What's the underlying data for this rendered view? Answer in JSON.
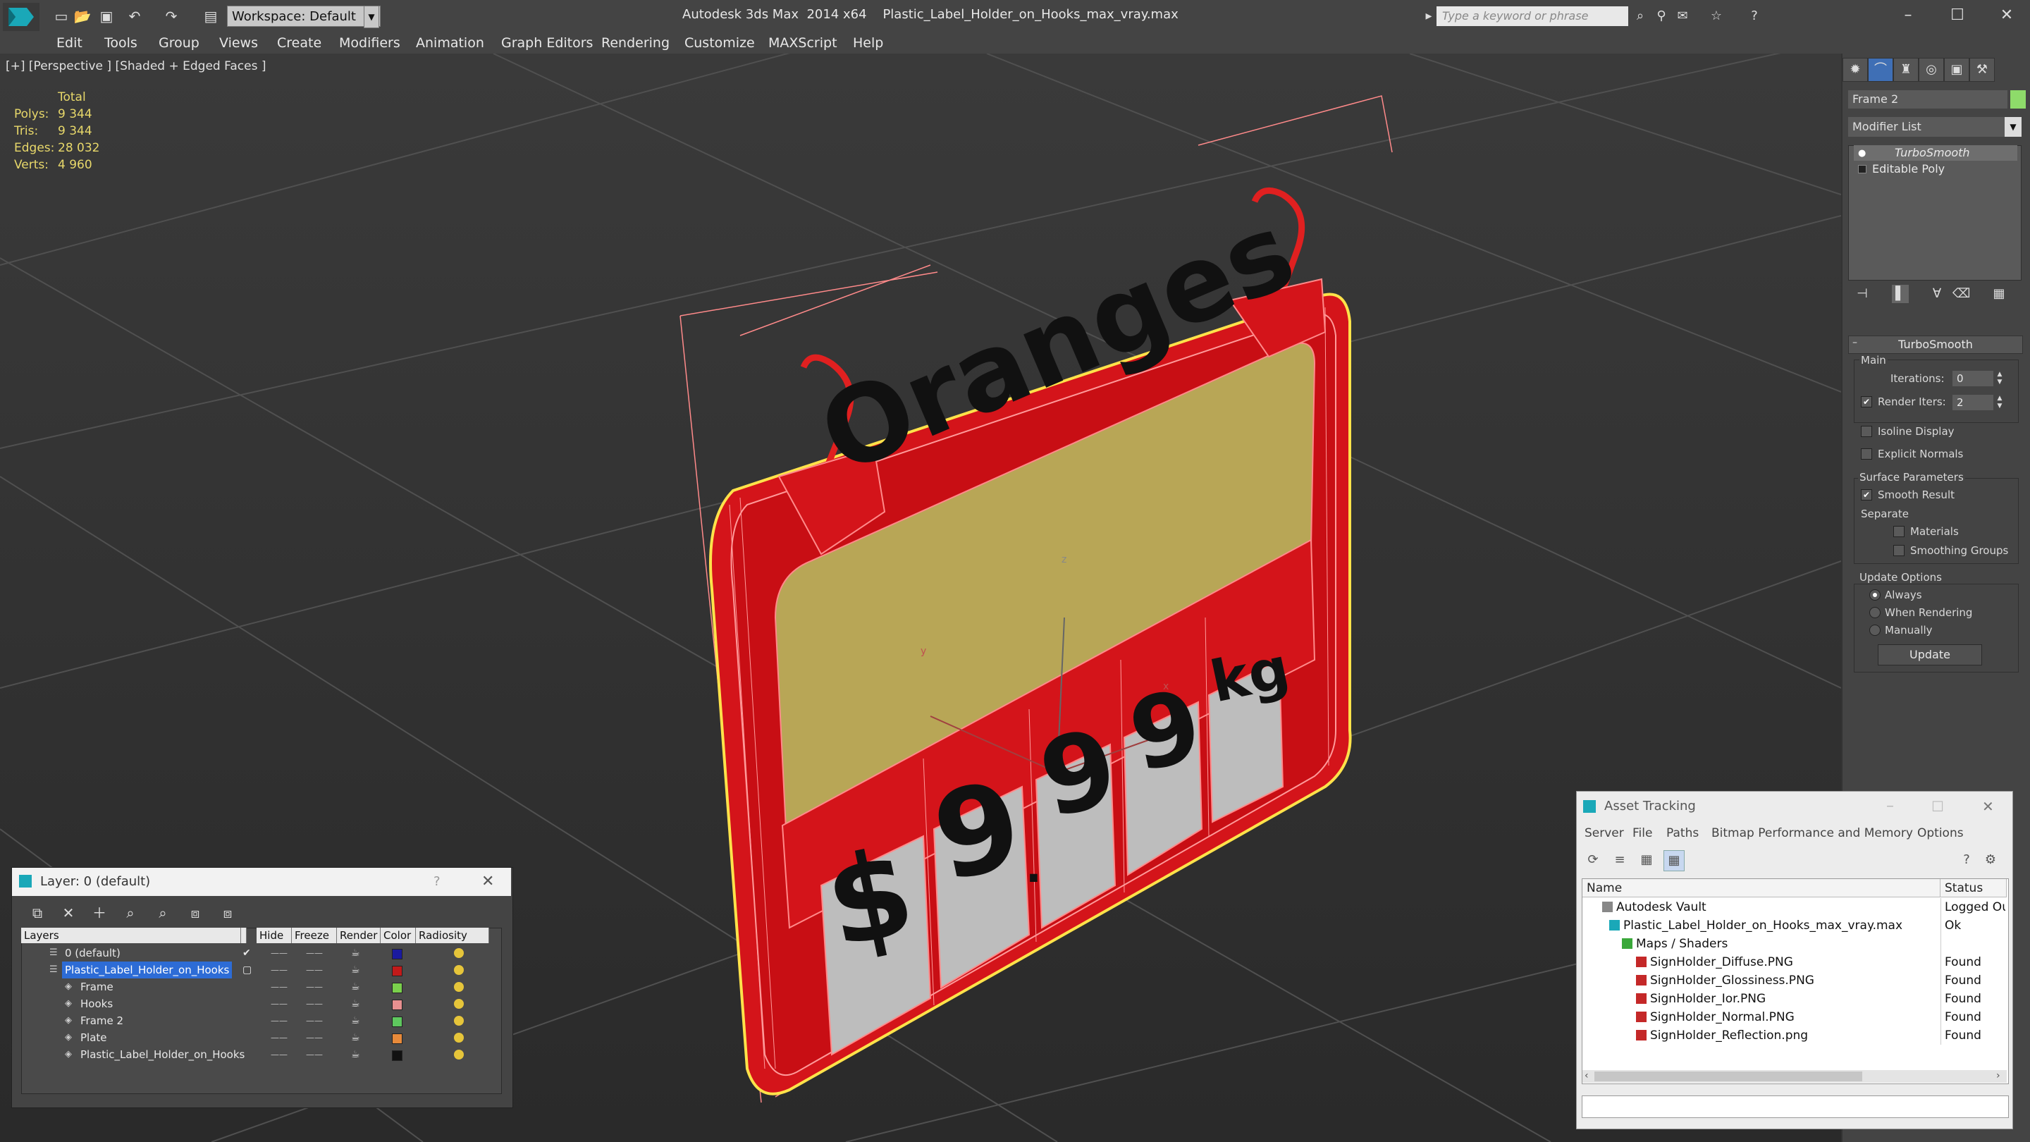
{
  "titlebar": {
    "workspace": "Workspace: Default",
    "app_name": "Autodesk 3ds Max  2014 x64",
    "file_name": "Plastic_Label_Holder_on_Hooks_max_vray.max",
    "search_placeholder": "Type a keyword or phrase"
  },
  "menus": [
    "Edit",
    "Tools",
    "Group",
    "Views",
    "Create",
    "Modifiers",
    "Animation",
    "Graph Editors",
    "Rendering",
    "Customize",
    "MAXScript",
    "Help"
  ],
  "viewport": {
    "label": "[+] [Perspective ] [Shaded + Edged Faces ]",
    "stats": {
      "total_label": "Total",
      "polys_label": "Polys:",
      "polys": "9 344",
      "tris_label": "Tris:",
      "tris": "9 344",
      "edges_label": "Edges:",
      "edges": "28 032",
      "verts_label": "Verts:",
      "verts": "4 960"
    },
    "sign": {
      "title": "Oranges",
      "currency": "$",
      "d1": "9",
      "dot": ".",
      "d2": "9",
      "d3": "9",
      "unit": "kg"
    },
    "axis_x": "x",
    "axis_y": "y",
    "axis_z": "z"
  },
  "command_panel": {
    "object_name": "Frame 2",
    "object_color": "#8edb6a",
    "modifier_list": "Modifier List",
    "stack": [
      "TurboSmooth",
      "Editable Poly"
    ],
    "rollout_title": "TurboSmooth",
    "main_label": "Main",
    "iterations_label": "Iterations:",
    "iterations": "0",
    "render_iters_label": "Render Iters:",
    "render_iters": "2",
    "isoline_label": "Isoline Display",
    "explicit_normals_label": "Explicit Normals",
    "surface_params_label": "Surface Parameters",
    "smooth_result_label": "Smooth Result",
    "separate_label": "Separate",
    "materials_label": "Materials",
    "smoothing_groups_label": "Smoothing Groups",
    "update_options_label": "Update Options",
    "always_label": "Always",
    "when_rendering_label": "When Rendering",
    "manually_label": "Manually",
    "update_button": "Update"
  },
  "layer_dialog": {
    "title": "Layer: 0 (default)",
    "help": "?",
    "columns": [
      "Layers",
      "Hide",
      "Freeze",
      "Render",
      "Color",
      "Radiosity"
    ],
    "rows": [
      {
        "name": "0 (default)",
        "color": "#1a1aa0"
      },
      {
        "name": "Plastic_Label_Holder_on_Hooks",
        "color": "#c21a1a"
      },
      {
        "name": "Frame",
        "color": "#7ad04c"
      },
      {
        "name": "Hooks",
        "color": "#e89090"
      },
      {
        "name": "Frame 2",
        "color": "#5ec85e"
      },
      {
        "name": "Plate",
        "color": "#e88a3a"
      },
      {
        "name": "Plastic_Label_Holder_on_Hooks",
        "color": "#111111"
      }
    ]
  },
  "asset_tracking": {
    "title": "Asset Tracking",
    "menus": [
      "Server",
      "File",
      "Paths",
      "Bitmap Performance and Memory",
      "Options"
    ],
    "columns": [
      "Name",
      "Status"
    ],
    "rows": [
      {
        "name": "Autodesk Vault",
        "status": "Logged Ou"
      },
      {
        "name": "Plastic_Label_Holder_on_Hooks_max_vray.max",
        "status": "Ok"
      },
      {
        "name": "Maps / Shaders",
        "status": ""
      },
      {
        "name": "SignHolder_Diffuse.PNG",
        "status": "Found"
      },
      {
        "name": "SignHolder_Glossiness.PNG",
        "status": "Found"
      },
      {
        "name": "SignHolder_Ior.PNG",
        "status": "Found"
      },
      {
        "name": "SignHolder_Normal.PNG",
        "status": "Found"
      },
      {
        "name": "SignHolder_Reflection.png",
        "status": "Found"
      }
    ]
  },
  "colors": {
    "sign_red": "#d4141a",
    "sign_yellow": "#b8a656",
    "sign_grey": "#bdbdbd",
    "wire": "#ff8a8a",
    "selection": "#2d6cd6"
  }
}
